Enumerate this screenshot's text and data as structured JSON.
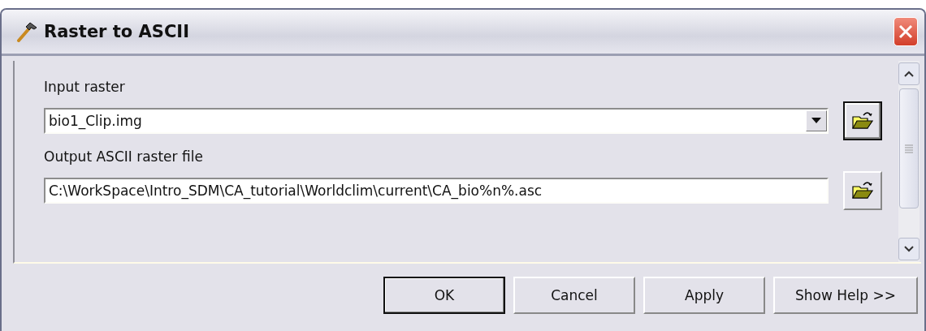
{
  "window": {
    "title": "Raster to ASCII"
  },
  "fields": [
    {
      "label": "Input raster",
      "value": "bio1_Clip.img",
      "kind": "dropdown",
      "browse_focused": true
    },
    {
      "label": "Output ASCII raster file",
      "value": "C:\\WorkSpace\\Intro_SDM\\CA_tutorial\\Worldclim\\current\\CA_bio%n%.asc",
      "kind": "text",
      "browse_focused": false
    }
  ],
  "buttons": [
    {
      "label": "OK",
      "default": true
    },
    {
      "label": "Cancel",
      "default": false
    },
    {
      "label": "Apply",
      "default": false
    },
    {
      "label": "Show Help >>",
      "default": false
    }
  ]
}
